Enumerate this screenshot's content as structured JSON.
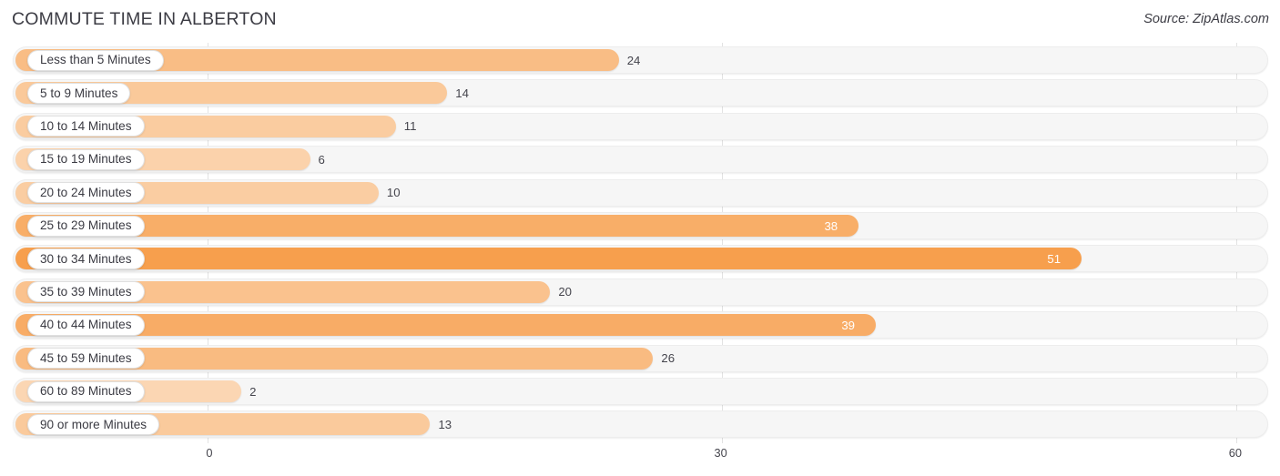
{
  "header": {
    "title": "COMMUTE TIME IN ALBERTON",
    "source": "Source: ZipAtlas.com"
  },
  "colors": {
    "bar_max": "#F79F4D",
    "bar_min": "#FBD6B3",
    "track": "#F6F6F6",
    "gridline": "#E2E2E2",
    "text": "#45454D",
    "title": "#3C3C44"
  },
  "chart_data": {
    "type": "bar",
    "orientation": "horizontal",
    "title": "COMMUTE TIME IN ALBERTON",
    "xlabel": "",
    "ylabel": "",
    "xlim": [
      0,
      60
    ],
    "ticks": [
      "0",
      "30",
      "60"
    ],
    "tick_values": [
      0,
      30,
      60
    ],
    "grid": true,
    "legend": null,
    "categories": [
      "Less than 5 Minutes",
      "5 to 9 Minutes",
      "10 to 14 Minutes",
      "15 to 19 Minutes",
      "20 to 24 Minutes",
      "25 to 29 Minutes",
      "30 to 34 Minutes",
      "35 to 39 Minutes",
      "40 to 44 Minutes",
      "45 to 59 Minutes",
      "60 to 89 Minutes",
      "90 or more Minutes"
    ],
    "values": [
      24,
      14,
      11,
      6,
      10,
      38,
      51,
      20,
      39,
      26,
      2,
      13
    ],
    "value_labels": [
      "24",
      "14",
      "11",
      "6",
      "10",
      "38",
      "51",
      "20",
      "39",
      "26",
      "2",
      "13"
    ]
  }
}
